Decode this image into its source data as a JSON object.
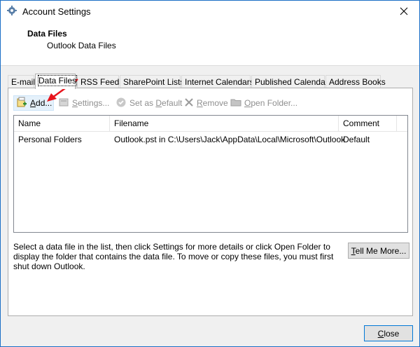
{
  "window": {
    "title": "Account Settings",
    "accent_color": "#1b6fc6",
    "icons": {
      "app": "settings-app-icon",
      "close": "close-icon"
    }
  },
  "header": {
    "title": "Data Files",
    "subtitle": "Outlook Data Files"
  },
  "tabs": [
    {
      "label": "E-mail"
    },
    {
      "label": "Data Files",
      "active": true
    },
    {
      "label": "RSS Feeds"
    },
    {
      "label": "SharePoint Lists"
    },
    {
      "label": "Internet Calendars"
    },
    {
      "label": "Published Calendars"
    },
    {
      "label": "Address Books"
    }
  ],
  "toolbar": {
    "add": {
      "accel": "A",
      "rest": "dd...",
      "enabled": true,
      "icon": "add-file-icon"
    },
    "settings": {
      "accel": "S",
      "rest": "ettings...",
      "enabled": false,
      "icon": "settings-icon"
    },
    "set_default": {
      "before": "Set as ",
      "accel": "D",
      "after": "efault",
      "enabled": false,
      "icon": "checkmark-icon"
    },
    "remove": {
      "accel": "R",
      "rest": "emove",
      "enabled": false,
      "icon": "remove-x-icon"
    },
    "open_folder": {
      "accel": "O",
      "rest": "pen Folder...",
      "enabled": false,
      "icon": "folder-icon"
    }
  },
  "list": {
    "columns": [
      "Name",
      "Filename",
      "Comment"
    ],
    "rows": [
      {
        "name": "Personal Folders",
        "filename": "Outlook.pst in C:\\Users\\Jack\\AppData\\Local\\Microsoft\\Outlook",
        "comment": "Default"
      }
    ]
  },
  "help_text": "Select a data file in the list, then click Settings for more details or click Open Folder to display the folder that contains the data file. To move or copy these files, you must first shut down Outlook.",
  "buttons": {
    "tell_me": {
      "accel": "T",
      "rest": "ell Me More..."
    },
    "close": {
      "accel": "C",
      "rest": "lose"
    }
  },
  "annotation": {
    "arrow_color": "#e8141c",
    "icon": "red-arrow-annotation"
  }
}
